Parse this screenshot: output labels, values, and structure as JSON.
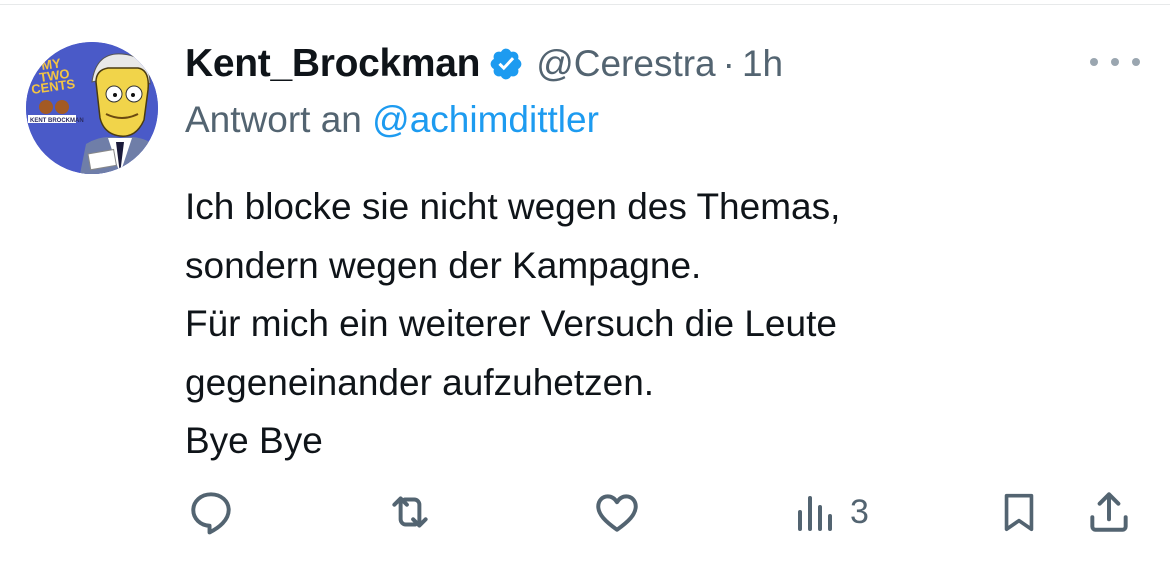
{
  "tweet": {
    "author_name": "Kent_Brockman",
    "handle": "@Cerestra",
    "separator": "·",
    "time": "1h",
    "reply_prefix": "Antwort an",
    "reply_to": "@achimdittler",
    "text_lines": [
      "Ich blocke sie nicht wegen des Themas,",
      "sondern wegen der Kampagne.",
      "Für mich ein weiterer Versuch die Leute",
      "gegeneinander aufzuhetzen.",
      "Bye Bye"
    ],
    "avatar_text": {
      "line1": "MY",
      "line2": "TWO",
      "line3": "CENTS",
      "name": "KENT BROCKMAN"
    }
  },
  "actions": {
    "views": "3",
    "icons": [
      "reply-icon",
      "retweet-icon",
      "like-icon",
      "views-icon",
      "bookmark-icon",
      "share-icon"
    ]
  },
  "colors": {
    "text": "#0f1419",
    "secondary": "#536471",
    "accent": "#1d9bf0",
    "verified": "#1d9bf0",
    "avatar_bg": "#4a5ac8"
  }
}
